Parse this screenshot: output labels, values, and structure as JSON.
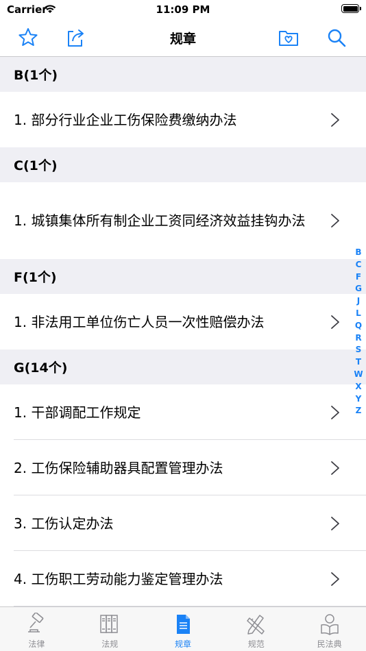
{
  "status_bar": {
    "carrier": "Carrier",
    "time": "11:09 PM"
  },
  "nav": {
    "title": "规章",
    "icons": [
      "star-icon",
      "share-icon",
      "favorites-folder-icon",
      "search-icon"
    ]
  },
  "sections": [
    {
      "header": "B(1个)",
      "items": [
        "1. 部分行业企业工伤保险费缴纳办法"
      ]
    },
    {
      "header": "C(1个)",
      "items": [
        "1. 城镇集体所有制企业工资同经济效益挂钩办法"
      ]
    },
    {
      "header": "F(1个)",
      "items": [
        "1. 非法用工单位伤亡人员一次性赔偿办法"
      ]
    },
    {
      "header": "G(14个)",
      "items": [
        "1. 干部调配工作规定",
        "2. 工伤保险辅助器具配置管理办法",
        "3. 工伤认定办法",
        "4. 工伤职工劳动能力鉴定管理办法"
      ]
    }
  ],
  "index_letters": [
    "B",
    "C",
    "F",
    "G",
    "J",
    "L",
    "Q",
    "R",
    "S",
    "T",
    "W",
    "X",
    "Y",
    "Z"
  ],
  "tabs": [
    {
      "label": "法律",
      "icon": "gavel-icon",
      "active": false
    },
    {
      "label": "法规",
      "icon": "books-icon",
      "active": false
    },
    {
      "label": "规章",
      "icon": "rules-document-icon",
      "active": true
    },
    {
      "label": "规范",
      "icon": "pencil-ruler-icon",
      "active": false
    },
    {
      "label": "民法典",
      "icon": "reader-icon",
      "active": false
    }
  ],
  "colors": {
    "accent": "#1a82f6",
    "section_bg": "#efeff4",
    "tab_inactive": "#8e8e93"
  }
}
